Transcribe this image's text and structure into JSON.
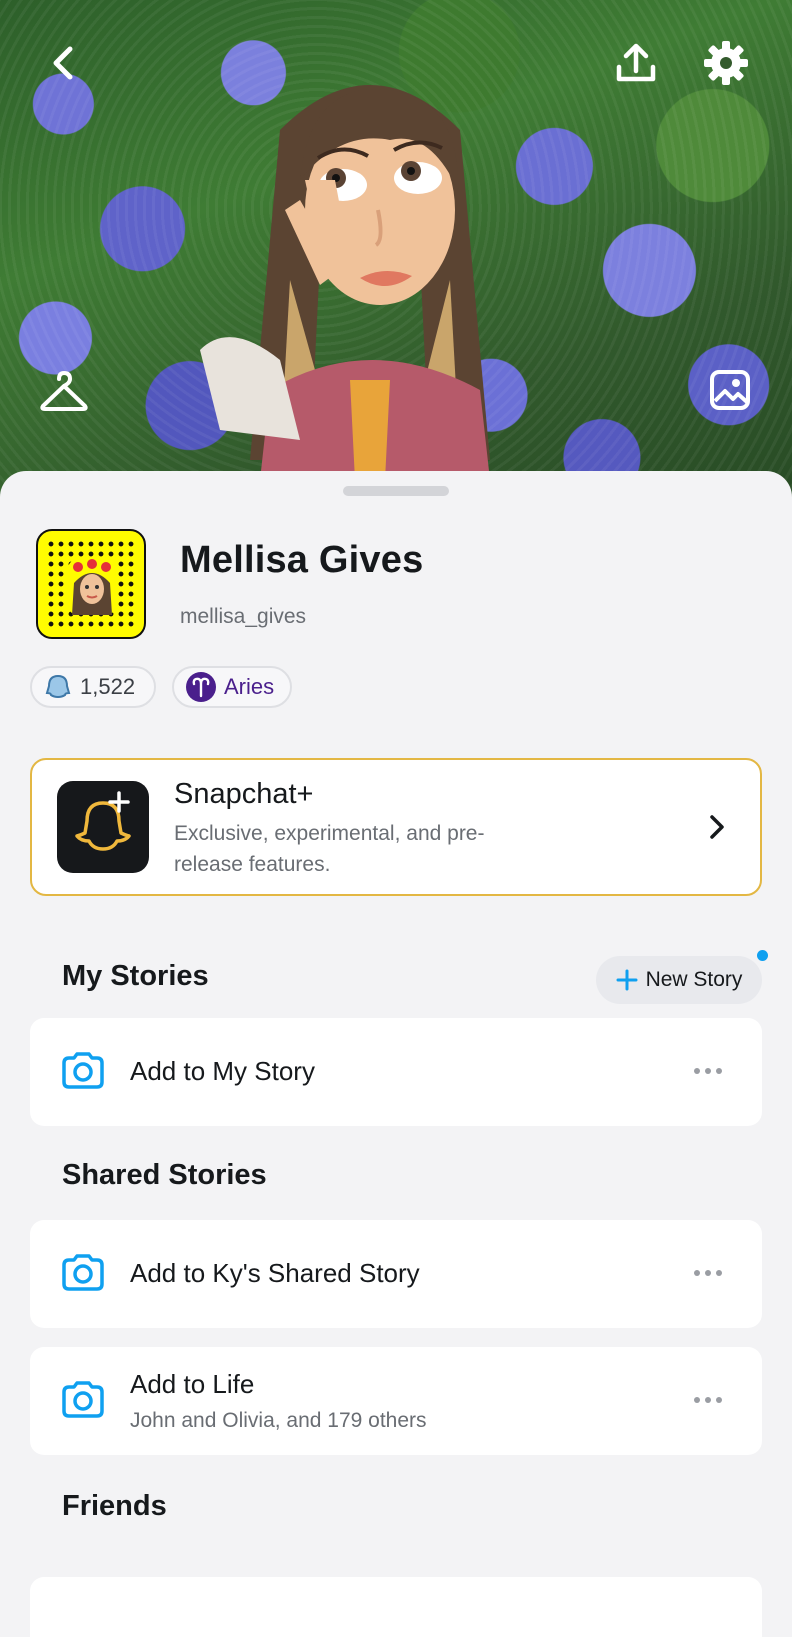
{
  "profile": {
    "display_name": "Mellisa Gives",
    "username": "mellisa_gives",
    "snap_score": "1,522",
    "zodiac": "Aries"
  },
  "snapchat_plus": {
    "title": "Snapchat+",
    "description": "Exclusive, experimental, and pre-release features."
  },
  "my_stories": {
    "heading": "My Stories",
    "new_story_label": "New Story",
    "items": [
      {
        "label": "Add to My Story"
      }
    ]
  },
  "shared_stories": {
    "heading": "Shared Stories",
    "items": [
      {
        "label": "Add to Ky's Shared Story",
        "sub": ""
      },
      {
        "label": "Add to Life",
        "sub": "John and Olivia, and 179 others"
      }
    ]
  },
  "friends": {
    "heading": "Friends"
  },
  "colors": {
    "accent_blue": "#0fa0f0",
    "snap_yellow": "#fffc00",
    "plus_gold": "#e3b743",
    "zodiac_purple": "#4a1f8c"
  },
  "icons": {
    "back": "chevron-left-icon",
    "share": "upload-icon",
    "settings": "gear-icon",
    "outfit": "hanger-icon",
    "background": "image-icon",
    "camera": "camera-icon"
  }
}
